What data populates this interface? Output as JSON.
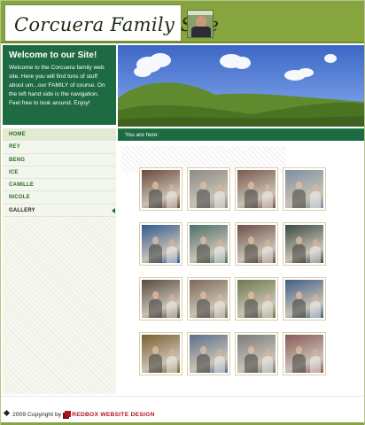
{
  "header": {
    "site_title": "Corcuera Family Site"
  },
  "welcome": {
    "heading": "Welcome to our Site!",
    "body": "Welcome to the Corcuera family web site. Here you will find tons of stuff about um...our FAMILY of course. On the left hand side is the navigation. Feel free to look around. Enjoy!"
  },
  "nav": {
    "items": [
      {
        "label": "HOME"
      },
      {
        "label": "REY"
      },
      {
        "label": "BENG"
      },
      {
        "label": "ICE"
      },
      {
        "label": "CAMILLE"
      },
      {
        "label": "NICOLE"
      },
      {
        "label": "GALLERY"
      }
    ],
    "active": "GALLERY"
  },
  "breadcrumb": {
    "label": "You are here:"
  },
  "gallery": {
    "rows": 4,
    "columns": 4,
    "photo_tints": [
      "#6b4a3a",
      "#8c8a86",
      "#7a5a4e",
      "#7d8fa0",
      "#2f5b8e",
      "#4f6f6a",
      "#6e5048",
      "#3b4a44",
      "#5a4a40",
      "#7c6a5a",
      "#6c7a4a",
      "#3f5f86",
      "#7a6030",
      "#5a6f8a",
      "#7b7b7b",
      "#8a5a5a"
    ]
  },
  "footer": {
    "copyright": "2009 Copyright by",
    "designer": "REDBOX WEBSITE DESIGN"
  },
  "colors": {
    "header_green": "#86a53e",
    "dark_green": "#1e6a43",
    "nav_text": "#2e6b26",
    "redbox": "#b0131d"
  }
}
